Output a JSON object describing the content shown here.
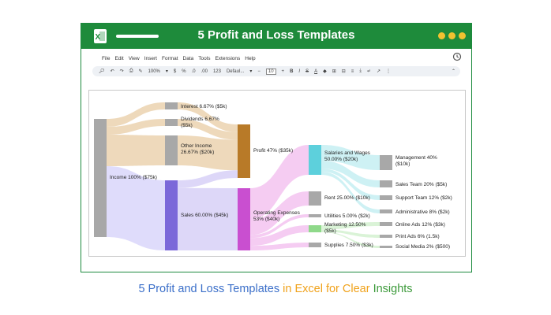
{
  "window": {
    "title": "5 Profit and Loss Templates",
    "dots_color": "#f2c230",
    "title_bar_color": "#1e8b3b"
  },
  "menu": {
    "items": [
      "File",
      "Edit",
      "View",
      "Insert",
      "Format",
      "Data",
      "Tools",
      "Extensions",
      "Help"
    ]
  },
  "toolbar": {
    "zoom": "100%",
    "currency": "$",
    "percent": "%",
    "decrease_decimals": ".0",
    "increase_decimals": ".00",
    "number_format": "123",
    "font": "Defaul...",
    "font_size": "10",
    "bold": "B",
    "italic": "I",
    "strikethrough": "S",
    "text_color": "A"
  },
  "chart_data": {
    "type": "sankey",
    "nodes": [
      {
        "name": "Interest 6.67% ($5k)",
        "color": "#a8a8a8"
      },
      {
        "name": "Dividends 6.67% ($5k)",
        "color": "#a8a8a8"
      },
      {
        "name": "Other Income 26.67% ($20k)",
        "color": "#a8a8a8"
      },
      {
        "name": "Income 100% ($75k)",
        "color": "#a8a8a8"
      },
      {
        "name": "Sales 60.00% ($45k)",
        "color": "#7b68d9"
      },
      {
        "name": "Profit 47% ($35k)",
        "color": "#b87a28"
      },
      {
        "name": "Operating Expenses 53% ($40k)",
        "color": "#c94fd0"
      },
      {
        "name": "Salaries and Wages 50.00% ($20k)",
        "color": "#5dd0dc"
      },
      {
        "name": "Rent 25.00% ($10k)",
        "color": "#a8a8a8"
      },
      {
        "name": "Utilities 5.00% ($2k)",
        "color": "#a8a8a8"
      },
      {
        "name": "Marketing 12.50% ($5k)",
        "color": "#8fd98a"
      },
      {
        "name": "Supplies 7.50% ($3k)",
        "color": "#a8a8a8"
      },
      {
        "name": "Management 40% ($10k)",
        "color": "#a8a8a8"
      },
      {
        "name": "Sales Team 20% ($5k)",
        "color": "#a8a8a8"
      },
      {
        "name": "Support Team 12% ($2k)",
        "color": "#a8a8a8"
      },
      {
        "name": "Administrative 8% ($2k)",
        "color": "#a8a8a8"
      },
      {
        "name": "Online Ads 12% ($3k)",
        "color": "#a8a8a8"
      },
      {
        "name": "Print Ads 6% (1.5k)",
        "color": "#a8a8a8"
      },
      {
        "name": "Social Media 2% ($500)",
        "color": "#a8a8a8"
      }
    ],
    "links": [
      {
        "source": "Income 100% ($75k)",
        "target": "Interest 6.67% ($5k)",
        "value": 5
      },
      {
        "source": "Income 100% ($75k)",
        "target": "Dividends 6.67% ($5k)",
        "value": 5
      },
      {
        "source": "Income 100% ($75k)",
        "target": "Other Income 26.67% ($20k)",
        "value": 20
      },
      {
        "source": "Income 100% ($75k)",
        "target": "Sales 60.00% ($45k)",
        "value": 45
      },
      {
        "source": "Interest 6.67% ($5k)",
        "target": "Profit 47% ($35k)",
        "value": 5
      },
      {
        "source": "Dividends 6.67% ($5k)",
        "target": "Profit 47% ($35k)",
        "value": 5
      },
      {
        "source": "Other Income 26.67% ($20k)",
        "target": "Profit 47% ($35k)",
        "value": 20
      },
      {
        "source": "Sales 60.00% ($45k)",
        "target": "Profit 47% ($35k)",
        "value": 5
      },
      {
        "source": "Sales 60.00% ($45k)",
        "target": "Operating Expenses 53% ($40k)",
        "value": 40
      },
      {
        "source": "Operating Expenses 53% ($40k)",
        "target": "Salaries and Wages 50.00% ($20k)",
        "value": 20
      },
      {
        "source": "Operating Expenses 53% ($40k)",
        "target": "Rent 25.00% ($10k)",
        "value": 10
      },
      {
        "source": "Operating Expenses 53% ($40k)",
        "target": "Utilities 5.00% ($2k)",
        "value": 2
      },
      {
        "source": "Operating Expenses 53% ($40k)",
        "target": "Marketing 12.50% ($5k)",
        "value": 5
      },
      {
        "source": "Operating Expenses 53% ($40k)",
        "target": "Supplies 7.50% ($3k)",
        "value": 3
      },
      {
        "source": "Salaries and Wages 50.00% ($20k)",
        "target": "Management 40% ($10k)",
        "value": 10
      },
      {
        "source": "Salaries and Wages 50.00% ($20k)",
        "target": "Sales Team 20% ($5k)",
        "value": 5
      },
      {
        "source": "Salaries and Wages 50.00% ($20k)",
        "target": "Support Team 12% ($2k)",
        "value": 2
      },
      {
        "source": "Salaries and Wages 50.00% ($20k)",
        "target": "Administrative 8% ($2k)",
        "value": 2
      },
      {
        "source": "Marketing 12.50% ($5k)",
        "target": "Online Ads 12% ($3k)",
        "value": 3
      },
      {
        "source": "Marketing 12.50% ($5k)",
        "target": "Print Ads 6% (1.5k)",
        "value": 1.5
      },
      {
        "source": "Marketing 12.50% ($5k)",
        "target": "Social Media 2% ($500)",
        "value": 0.5
      }
    ]
  },
  "caption": {
    "part1": "5 Profit and Loss Templates",
    "part2": " in Excel for Clear",
    "part3": " Insights",
    "color1": "#3b6fc9",
    "color2": "#f0a21b",
    "color3": "#3c9a3a"
  }
}
